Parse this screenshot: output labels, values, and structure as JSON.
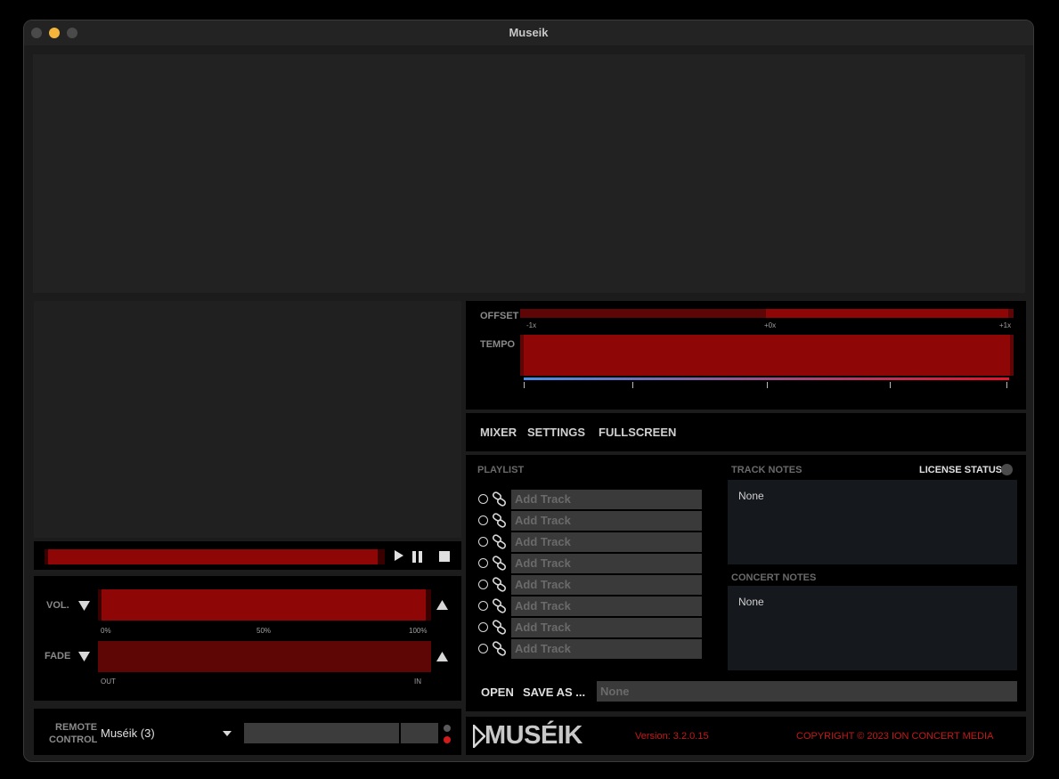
{
  "window": {
    "title": "Museik"
  },
  "colors": {
    "accent": "#8e0606",
    "accent_dark": "#5e0505",
    "panel": "#000000",
    "background": "#1c1c1c",
    "footer_text": "#c21a1a"
  },
  "transport": {
    "progress": 0.0,
    "icons": [
      "play-icon",
      "pause-icon",
      "stop-icon"
    ]
  },
  "volume": {
    "label": "VOL.",
    "level": 1.0,
    "ticks": [
      "0%",
      "50%",
      "100%"
    ]
  },
  "fade": {
    "label": "FADE",
    "ticks": [
      "OUT",
      "IN"
    ]
  },
  "remote": {
    "label_line1": "REMOTE",
    "label_line2": "CONTROL",
    "selected": "Muséik (3)"
  },
  "offset": {
    "label": "OFFSET",
    "value": 0.0,
    "ticks": [
      "-1x",
      "+0x",
      "+1x"
    ]
  },
  "tempo": {
    "label": "TEMPO"
  },
  "menu": {
    "mixer": "MIXER",
    "settings": "SETTINGS",
    "fullscreen": "FULLSCREEN"
  },
  "playlist": {
    "title": "PLAYLIST",
    "tracks": [
      {
        "placeholder": "Add Track"
      },
      {
        "placeholder": "Add Track"
      },
      {
        "placeholder": "Add Track"
      },
      {
        "placeholder": "Add Track"
      },
      {
        "placeholder": "Add Track"
      },
      {
        "placeholder": "Add Track"
      },
      {
        "placeholder": "Add Track"
      },
      {
        "placeholder": "Add Track"
      }
    ],
    "open_label": "OPEN",
    "save_as_label": "SAVE AS ...",
    "concert_name": "None"
  },
  "track_notes": {
    "title": "TRACK NOTES",
    "text": "None"
  },
  "license": {
    "label": "LICENSE STATUS"
  },
  "concert_notes": {
    "title": "CONCERT NOTES",
    "text": "None"
  },
  "footer": {
    "logo_text": "MUSÉIK",
    "version": "Version: 3.2.0.15",
    "copyright": "COPYRIGHT © 2023 ION CONCERT MEDIA"
  }
}
